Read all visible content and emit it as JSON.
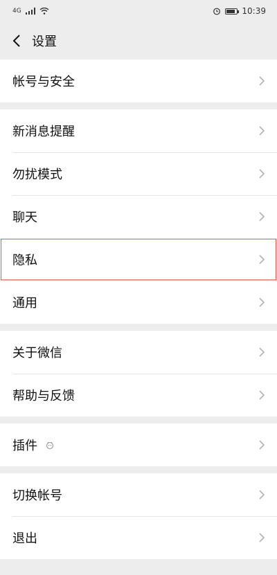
{
  "status": {
    "network": "4G",
    "time": "10:39"
  },
  "nav": {
    "title": "设置"
  },
  "groups": [
    {
      "items": [
        {
          "label": "帐号与安全"
        }
      ]
    },
    {
      "items": [
        {
          "label": "新消息提醒"
        },
        {
          "label": "勿扰模式"
        },
        {
          "label": "聊天"
        },
        {
          "label": "隐私"
        },
        {
          "label": "通用"
        }
      ]
    },
    {
      "items": [
        {
          "label": "关于微信"
        },
        {
          "label": "帮助与反馈"
        }
      ]
    },
    {
      "items": [
        {
          "label": "插件"
        }
      ]
    },
    {
      "items": [
        {
          "label": "切换帐号"
        },
        {
          "label": "退出"
        }
      ]
    }
  ],
  "icons": {
    "back": "chevron-left-icon",
    "row_arrow": "chevron-right-icon",
    "plugin_badge": "plugin-icon"
  },
  "colors": {
    "background": "#ededed",
    "highlight_outline": "#e15555"
  }
}
